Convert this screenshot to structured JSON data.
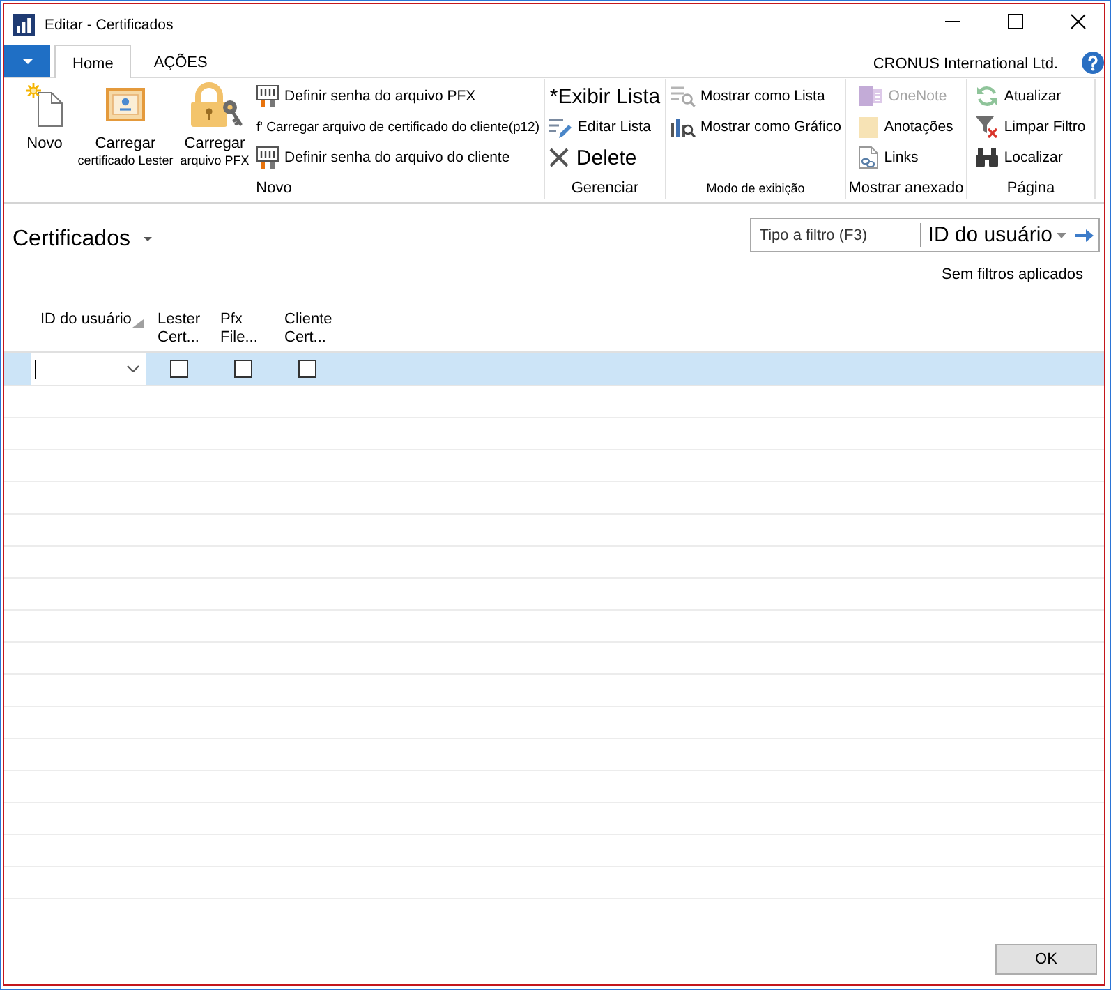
{
  "window": {
    "title": "Editar - Certificados"
  },
  "menu_tabs": [
    {
      "label": "Home",
      "selected": true
    },
    {
      "label": "AÇÕES",
      "selected": false
    }
  ],
  "company": "CRONUS International Ltd.",
  "ribbon": {
    "groups": [
      {
        "label": "Novo",
        "items": [
          {
            "kind": "large",
            "label": "Novo",
            "disabled": false
          },
          {
            "kind": "large",
            "label": "Carregar certificado Lester",
            "disabled": false
          },
          {
            "kind": "large",
            "label": "Carregar arquivo PFX",
            "disabled": false
          },
          {
            "kind": "small",
            "label": "Definir senha do arquivo PFX",
            "disabled": false
          },
          {
            "kind": "compact",
            "label": "f' Carregar arquivo de certificado do cliente(p12)",
            "disabled": false
          },
          {
            "kind": "small",
            "label": "Definir senha do arquivo do cliente",
            "disabled": false
          }
        ]
      },
      {
        "label": "Gerenciar",
        "items": [
          {
            "kind": "big-text",
            "label": "*Exibir Lista",
            "disabled": false
          },
          {
            "kind": "small",
            "label": "Editar Lista",
            "disabled": false
          },
          {
            "kind": "big-text",
            "label": "Delete",
            "disabled": false
          }
        ]
      },
      {
        "label": "Modo de exibição",
        "items": [
          {
            "kind": "small",
            "label": "Mostrar como Lista",
            "disabled": false
          },
          {
            "kind": "small",
            "label": "Mostrar como Gráfico",
            "disabled": false
          }
        ]
      },
      {
        "label": "Mostrar anexado",
        "items": [
          {
            "kind": "small",
            "label": "OneNote",
            "disabled": true
          },
          {
            "kind": "small",
            "label": "Anotações",
            "disabled": false
          },
          {
            "kind": "small",
            "label": "Links",
            "disabled": false
          }
        ]
      },
      {
        "label": "Página",
        "items": [
          {
            "kind": "small",
            "label": "Atualizar",
            "disabled": false
          },
          {
            "kind": "small",
            "label": "Limpar Filtro",
            "disabled": false
          },
          {
            "kind": "small",
            "label": "Localizar",
            "disabled": false
          }
        ]
      }
    ]
  },
  "page": {
    "title": "Certificados"
  },
  "filter": {
    "placeholder": "Tipo a filtro (F3)",
    "field": "ID do usuário",
    "status": "Sem filtros aplicados"
  },
  "grid": {
    "columns": [
      {
        "label": "ID do usuário",
        "sorted": true
      },
      {
        "label": "Lester Cert...",
        "sorted": false
      },
      {
        "label": "Pfx File...",
        "sorted": false
      },
      {
        "label": "Cliente Cert...",
        "sorted": false
      }
    ],
    "rows": [
      {
        "selected": true,
        "cells": [
          {
            "kind": "lookup",
            "focused": true
          },
          {
            "kind": "checkbox",
            "checked": false
          },
          {
            "kind": "checkbox",
            "checked": false
          },
          {
            "kind": "checkbox",
            "checked": false
          }
        ]
      }
    ]
  },
  "buttons": [
    "OK"
  ]
}
